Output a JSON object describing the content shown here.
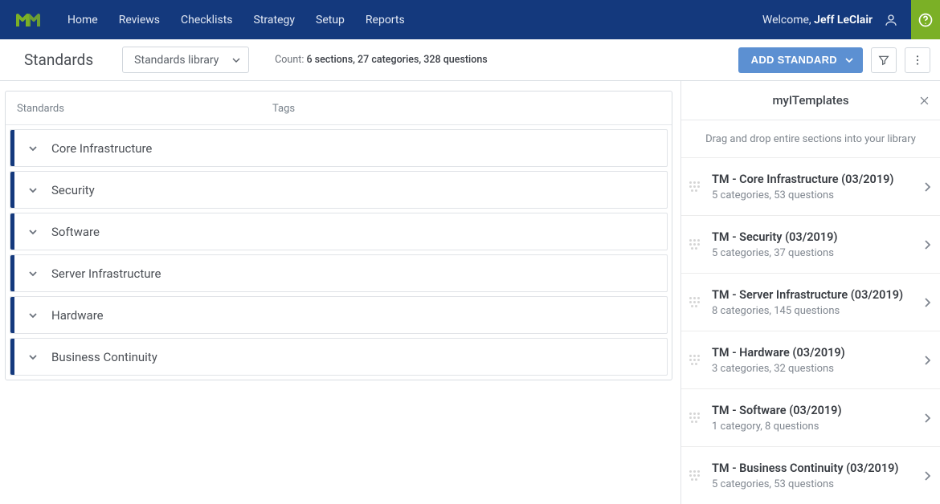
{
  "nav": {
    "links": [
      "Home",
      "Reviews",
      "Checklists",
      "Strategy",
      "Setup",
      "Reports"
    ],
    "welcome_prefix": "Welcome, ",
    "user_name": "Jeff LeClair"
  },
  "subbar": {
    "page_title": "Standards",
    "dropdown_label": "Standards library",
    "count_prefix": "Count: ",
    "count_value": "6 sections, 27 categories, 328 questions",
    "add_button": "ADD STANDARD"
  },
  "table": {
    "col_standards": "Standards",
    "col_tags": "Tags",
    "sections": [
      {
        "name": "Core Infrastructure"
      },
      {
        "name": "Security"
      },
      {
        "name": "Software"
      },
      {
        "name": "Server Infrastructure"
      },
      {
        "name": "Hardware"
      },
      {
        "name": "Business Continuity"
      }
    ]
  },
  "side": {
    "title": "myITemplates",
    "hint": "Drag and drop entire sections into your library",
    "templates": [
      {
        "title": "TM - Core Infrastructure (03/2019)",
        "sub": "5 categories, 53 questions"
      },
      {
        "title": "TM - Security (03/2019)",
        "sub": "5 categories, 37 questions"
      },
      {
        "title": "TM - Server Infrastructure (03/2019)",
        "sub": "8 categories, 145 questions"
      },
      {
        "title": "TM - Hardware (03/2019)",
        "sub": "3 categories, 32 questions"
      },
      {
        "title": "TM - Software (03/2019)",
        "sub": "1 category, 8 questions"
      },
      {
        "title": "TM - Business Continuity (03/2019)",
        "sub": "5 categories, 53 questions"
      }
    ]
  }
}
